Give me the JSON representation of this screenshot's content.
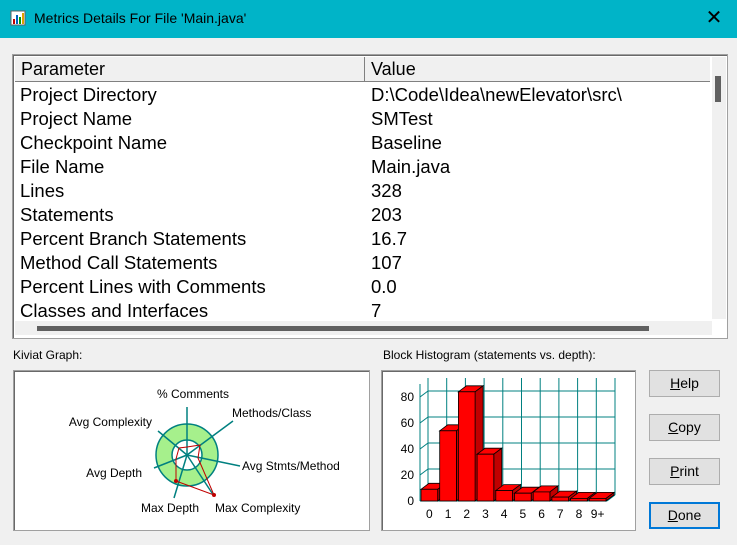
{
  "window": {
    "title": "Metrics Details For File 'Main.java'",
    "close_glyph": "✕"
  },
  "table": {
    "columns": [
      "Parameter",
      "Value"
    ],
    "rows": [
      {
        "param": "Project Directory",
        "value": "D:\\Code\\Idea\\newElevator\\src\\"
      },
      {
        "param": "Project Name",
        "value": "SMTest"
      },
      {
        "param": "Checkpoint Name",
        "value": "Baseline"
      },
      {
        "param": "File Name",
        "value": "Main.java"
      },
      {
        "param": "Lines",
        "value": "328"
      },
      {
        "param": "Statements",
        "value": "203"
      },
      {
        "param": "Percent Branch Statements",
        "value": "16.7"
      },
      {
        "param": "Method Call Statements",
        "value": "107"
      },
      {
        "param": "Percent Lines with Comments",
        "value": "0.0"
      },
      {
        "param": "Classes and Interfaces",
        "value": "7"
      }
    ]
  },
  "kiviat": {
    "label": "Kiviat Graph:",
    "axes": [
      "% Comments",
      "Methods/Class",
      "Avg Stmts/Method",
      "Max Complexity",
      "Max Depth",
      "Avg Depth",
      "Avg Complexity"
    ],
    "colors": {
      "band": "#a6f08c",
      "axis": "#008080",
      "polygon": "#c00000"
    }
  },
  "histogram": {
    "label": "Block Histogram (statements vs. depth):",
    "chart_data": {
      "type": "bar",
      "categories": [
        "0",
        "1",
        "2",
        "3",
        "4",
        "5",
        "6",
        "7",
        "8",
        "9+"
      ],
      "values": [
        9,
        54,
        84,
        36,
        8,
        6,
        7,
        3,
        2,
        2
      ],
      "yticks": [
        "0",
        "20",
        "40",
        "60",
        "80"
      ],
      "ylim": [
        0,
        90
      ],
      "grid": true,
      "colors": {
        "bar": "#ff0000",
        "grid": "#008080"
      }
    }
  },
  "buttons": {
    "help": {
      "pre": "",
      "key": "H",
      "post": "elp"
    },
    "copy": {
      "pre": "",
      "key": "C",
      "post": "opy"
    },
    "print": {
      "pre": "",
      "key": "P",
      "post": "rint"
    },
    "done": {
      "pre": "",
      "key": "D",
      "post": "one"
    }
  }
}
